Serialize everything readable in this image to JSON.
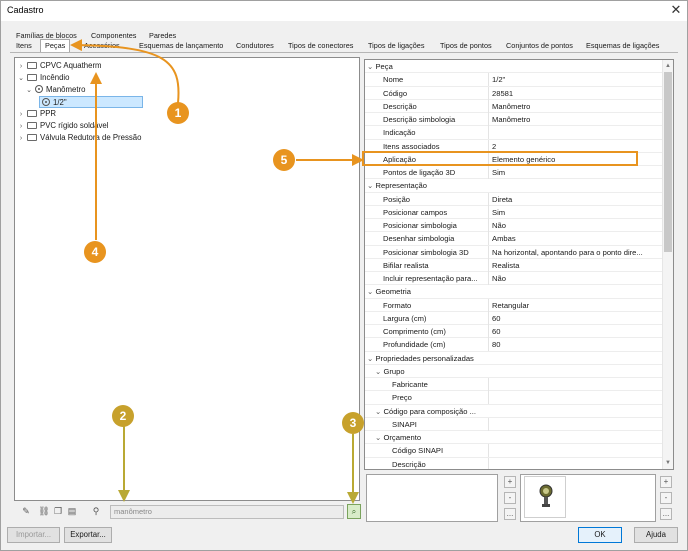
{
  "window": {
    "title": "Cadastro",
    "close_glyph": "✕"
  },
  "tabs_row1": [
    "Famílias de blocos",
    "Componentes",
    "Paredes"
  ],
  "tabs_row2": [
    "Itens",
    "Peças",
    "Acessórios",
    "Esquemas de lançamento",
    "Condutores",
    "Tipos de conectores",
    "Tipos de ligações",
    "Tipos de pontos",
    "Conjuntos de pontos",
    "Esquemas de ligações"
  ],
  "selected_tab": "Peças",
  "tree": {
    "items": [
      {
        "label": "CPVC Aquatherm",
        "expanded": false
      },
      {
        "label": "Incêndio",
        "expanded": true
      },
      {
        "label": "Manômetro",
        "expanded": true
      },
      {
        "label": "1/2\"",
        "selected": true
      },
      {
        "label": "PPR",
        "expanded": false
      },
      {
        "label": "PVC rígido soldável",
        "expanded": false
      },
      {
        "label": "Válvula Redutora de Pressão",
        "expanded": false
      }
    ]
  },
  "search": {
    "value": "manômetro"
  },
  "properties": {
    "groups": [
      {
        "title": "Peça",
        "rows": [
          [
            "Nome",
            "1/2\""
          ],
          [
            "Código",
            "28581"
          ],
          [
            "Descrição",
            "Manômetro"
          ],
          [
            "Descrição simbologia",
            "Manômetro"
          ],
          [
            "Indicação",
            ""
          ],
          [
            "Itens associados",
            "2"
          ],
          [
            "Aplicação",
            "Elemento genérico"
          ],
          [
            "Pontos de ligação 3D",
            "Sim"
          ]
        ]
      },
      {
        "title": "Representação",
        "rows": [
          [
            "Posição",
            "Direta"
          ],
          [
            "Posicionar campos",
            "Sim"
          ],
          [
            "Posicionar simbologia",
            "Não"
          ],
          [
            "Desenhar simbologia",
            "Ambas"
          ],
          [
            "Posicionar simbologia 3D",
            "Na horizontal, apontando para o ponto dire..."
          ],
          [
            "Bifilar realista",
            "Realista"
          ],
          [
            "Incluir representação para...",
            "Não"
          ]
        ]
      },
      {
        "title": "Geometria",
        "rows": [
          [
            "Formato",
            "Retangular"
          ],
          [
            "Largura (cm)",
            "60"
          ],
          [
            "Comprimento (cm)",
            "60"
          ],
          [
            "Profundidade (cm)",
            "80"
          ]
        ]
      },
      {
        "title": "Propriedades personalizadas",
        "rows": []
      }
    ],
    "custom": [
      {
        "title": "Grupo",
        "rows": [
          [
            "Fabricante",
            ""
          ],
          [
            "Preço",
            ""
          ]
        ]
      },
      {
        "title": "Código para composição ...",
        "rows": [
          [
            "SINAPI",
            ""
          ]
        ]
      },
      {
        "title": "Orçamento",
        "rows": [
          [
            "Código SINAPI",
            ""
          ],
          [
            "Descrição",
            ""
          ]
        ]
      }
    ]
  },
  "side_buttons": [
    "+",
    "-",
    "..."
  ],
  "buttons": {
    "import": "Importar...",
    "export": "Exportar...",
    "ok": "OK",
    "help": "Ajuda"
  },
  "markers": [
    "1",
    "2",
    "3",
    "4",
    "5"
  ],
  "colors": {
    "marker_orange": "#e8941f",
    "marker_olive": "#c7a12c",
    "selection": "#cce8ff",
    "search_button": "#d8ecc8"
  }
}
